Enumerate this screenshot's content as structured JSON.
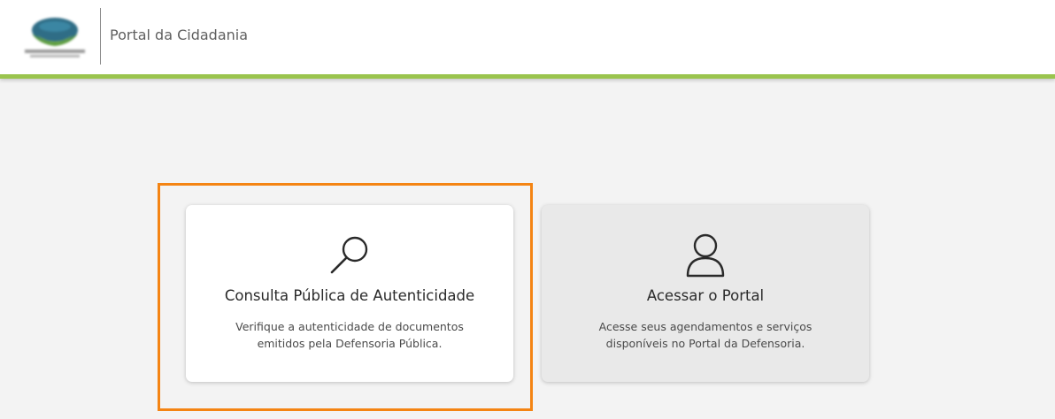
{
  "header": {
    "title": "Portal da Cidadania",
    "accent_color": "#9ac44e",
    "logo": "institution-logo"
  },
  "cards": [
    {
      "icon": "search-icon",
      "title": "Consulta Pública de Autenticidade",
      "description_line1": "Verifique a autenticidade de documentos",
      "description_line2": "emitidos pela Defensoria Pública.",
      "highlighted": true,
      "highlight_color": "#f48413"
    },
    {
      "icon": "user-icon",
      "title": "Acessar o Portal",
      "description_line1": "Acesse seus agendamentos e serviços",
      "description_line2": "disponíveis no Portal da Defensoria."
    }
  ]
}
